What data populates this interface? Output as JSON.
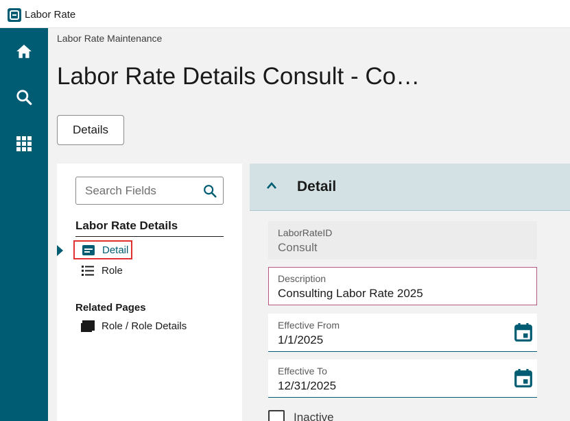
{
  "window": {
    "title": "Labor Rate"
  },
  "nav": {
    "items": [
      {
        "name": "home",
        "icon": "home-icon"
      },
      {
        "name": "search",
        "icon": "search-icon"
      },
      {
        "name": "apps",
        "icon": "apps-grid-icon"
      }
    ]
  },
  "breadcrumb": "Labor Rate Maintenance",
  "page_title": "Labor Rate Details Consult - Co…",
  "details_button": "Details",
  "left_panel": {
    "search_placeholder": "Search Fields",
    "heading": "Labor Rate Details",
    "items": [
      {
        "label": "Detail",
        "icon": "detail-card-icon",
        "active": true
      },
      {
        "label": "Role",
        "icon": "list-icon",
        "active": false
      }
    ],
    "related_heading": "Related Pages",
    "related_items": [
      {
        "label": "Role / Role Details",
        "icon": "stacked-pages-icon"
      }
    ]
  },
  "group": {
    "title": "Detail",
    "fields": {
      "labor_rate_id": {
        "label": "LaborRateID",
        "value": "Consult"
      },
      "description": {
        "label": "Description",
        "value": "Consulting Labor Rate 2025"
      },
      "effective_from": {
        "label": "Effective From",
        "value": "1/1/2025"
      },
      "effective_to": {
        "label": "Effective To",
        "value": "12/31/2025"
      }
    },
    "inactive_label": "Inactive"
  },
  "colors": {
    "brand": "#005c72",
    "group_header": "#d3e0e4",
    "focus_border": "#b5577e",
    "highlight": "#e03030"
  }
}
